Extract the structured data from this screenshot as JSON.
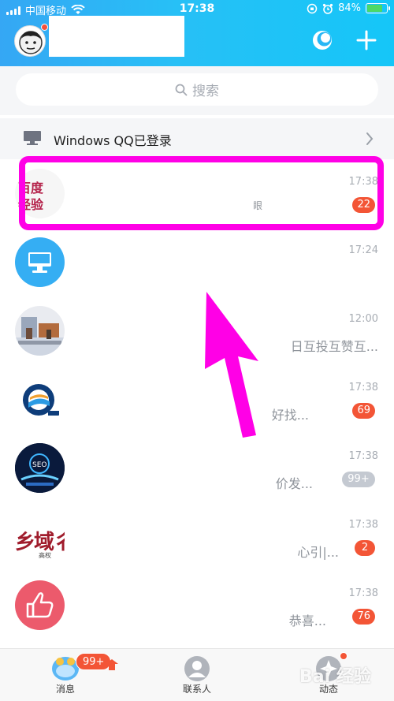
{
  "status_bar": {
    "carrier": "中国移动",
    "time": "17:38",
    "battery": "84%",
    "battery_level": 0.84
  },
  "header": {
    "icons": [
      "avatar",
      "qzone-icon",
      "plus-icon"
    ]
  },
  "search": {
    "placeholder": "搜索"
  },
  "pc_banner": {
    "text": "Windows QQ已登录"
  },
  "conversations": [
    {
      "avatar": "百度经验",
      "time": "17:38",
      "preview": "",
      "badge": "22",
      "tail": "眼"
    },
    {
      "avatar": "monitor-icon",
      "time": "17:24",
      "preview": "",
      "badge": ""
    },
    {
      "avatar": "group-photo",
      "time": "12:00",
      "preview": "日互投互赞互...",
      "badge": ""
    },
    {
      "avatar": "orange-logo",
      "time": "17:38",
      "preview": "好找...",
      "badge": "69"
    },
    {
      "avatar": "seo-logo",
      "time": "17:38",
      "preview": "价发...",
      "badge": "99+"
    },
    {
      "avatar": "域名logo",
      "time": "17:38",
      "preview": "心引|...",
      "badge": "2",
      "avatar_text": "乡域彳",
      "avatar_sub": "高权"
    },
    {
      "avatar": "thumbs-up-icon",
      "time": "17:38",
      "preview": "恭喜...",
      "badge": "76"
    }
  ],
  "tabs": {
    "messages": "消息",
    "contacts": "联系人",
    "moments": "动态",
    "messages_badge": "99+"
  },
  "watermark": "Bai 经验",
  "colors": {
    "header_start": "#35a7f4",
    "header_end": "#15c6f8",
    "badge_red": "#f35536",
    "highlight": "#ff00e6"
  }
}
